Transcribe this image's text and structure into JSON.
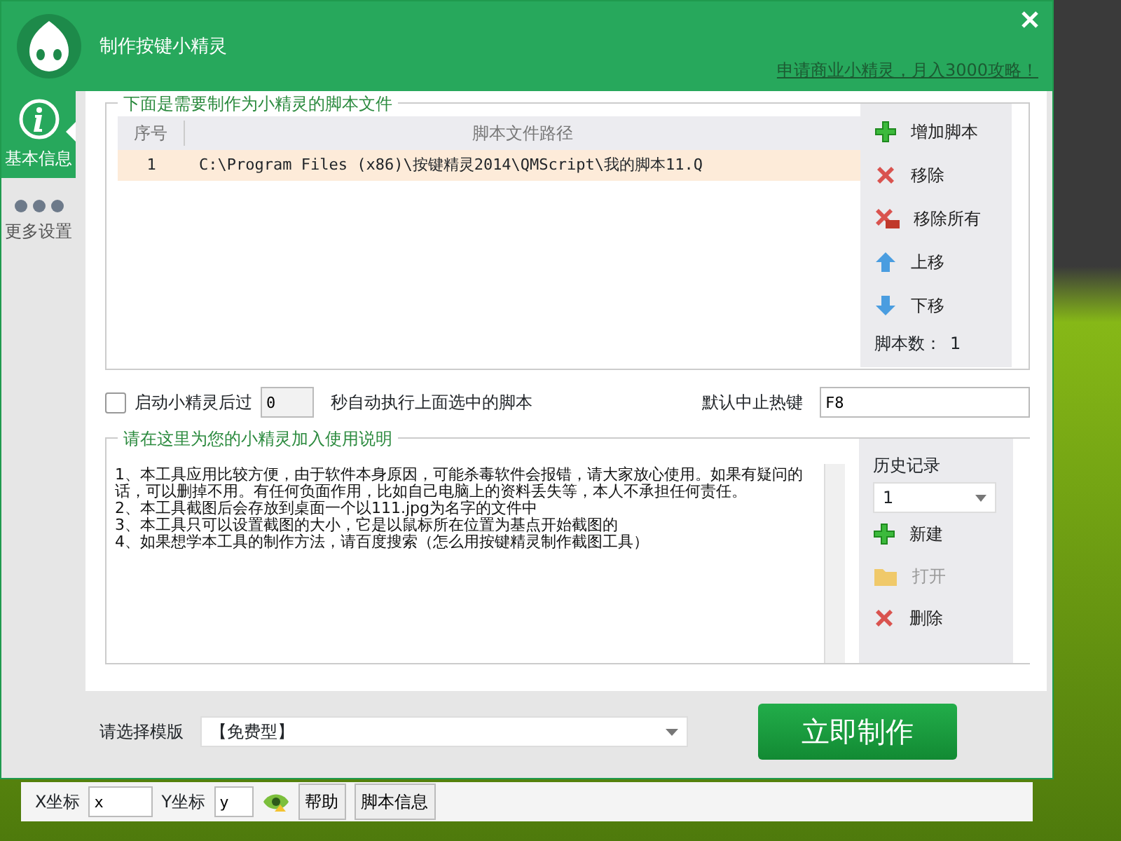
{
  "window": {
    "title": "制作按键小精灵",
    "promo_link": "申请商业小精灵，月入3000攻略！"
  },
  "sidebar": {
    "items": [
      {
        "label": "基本信息",
        "kind": "info",
        "selected": true
      },
      {
        "label": "更多设置",
        "kind": "dots",
        "selected": false
      }
    ]
  },
  "scripts": {
    "legend": "下面是需要制作为小精灵的脚本文件",
    "columns": [
      "序号",
      "脚本文件路径"
    ],
    "rows": [
      {
        "cells": [
          "1",
          "C:\\Program Files (x86)\\按键精灵2014\\QMScript\\我的脚本11.Q"
        ],
        "selected": true
      }
    ],
    "actions": [
      {
        "label": "增加脚本",
        "kind": "add"
      },
      {
        "label": "移除",
        "kind": "remove"
      },
      {
        "label": "移除所有",
        "kind": "remove-all"
      },
      {
        "label": "上移",
        "kind": "up"
      },
      {
        "label": "下移",
        "kind": "down"
      }
    ],
    "count_label": "脚本数：",
    "count": "1"
  },
  "autorun": {
    "checked": false,
    "label_before": "启动小精灵后过",
    "seconds": "0",
    "label_after": "秒自动执行上面选中的脚本"
  },
  "hotkey": {
    "label": "默认中止热键",
    "value": "F8"
  },
  "instructions": {
    "legend": "请在这里为您的小精灵加入使用说明",
    "lines": [
      "1、本工具应用比较方便，由于软件本身原因，可能杀毒软件会报错，请大家放心使用。如果有疑问的话，可以删掉不用。有任何负面作用，比如自己电脑上的资料丢失等，本人不承担任何责任。",
      "2、本工具截图后会存放到桌面一个以111.jpg为名字的文件中",
      "3、本工具只可以设置截图的大小，它是以鼠标所在位置为基点开始截图的",
      "4、如果想学本工具的制作方法，请百度搜索（怎么用按键精灵制作截图工具）"
    ]
  },
  "history": {
    "label": "历史记录",
    "value": "1",
    "actions": [
      {
        "label": "新建",
        "kind": "add",
        "disabled": false
      },
      {
        "label": "打开",
        "kind": "folder",
        "disabled": true
      },
      {
        "label": "删除",
        "kind": "remove",
        "disabled": false
      }
    ]
  },
  "template": {
    "label": "请选择模版",
    "value": "【免费型】"
  },
  "make_button": "立即制作",
  "coords": {
    "x_label": "X坐标",
    "x_value": "x",
    "y_label": "Y坐标",
    "y_value": "y"
  },
  "bottom_buttons": [
    "帮助",
    "脚本信息"
  ]
}
